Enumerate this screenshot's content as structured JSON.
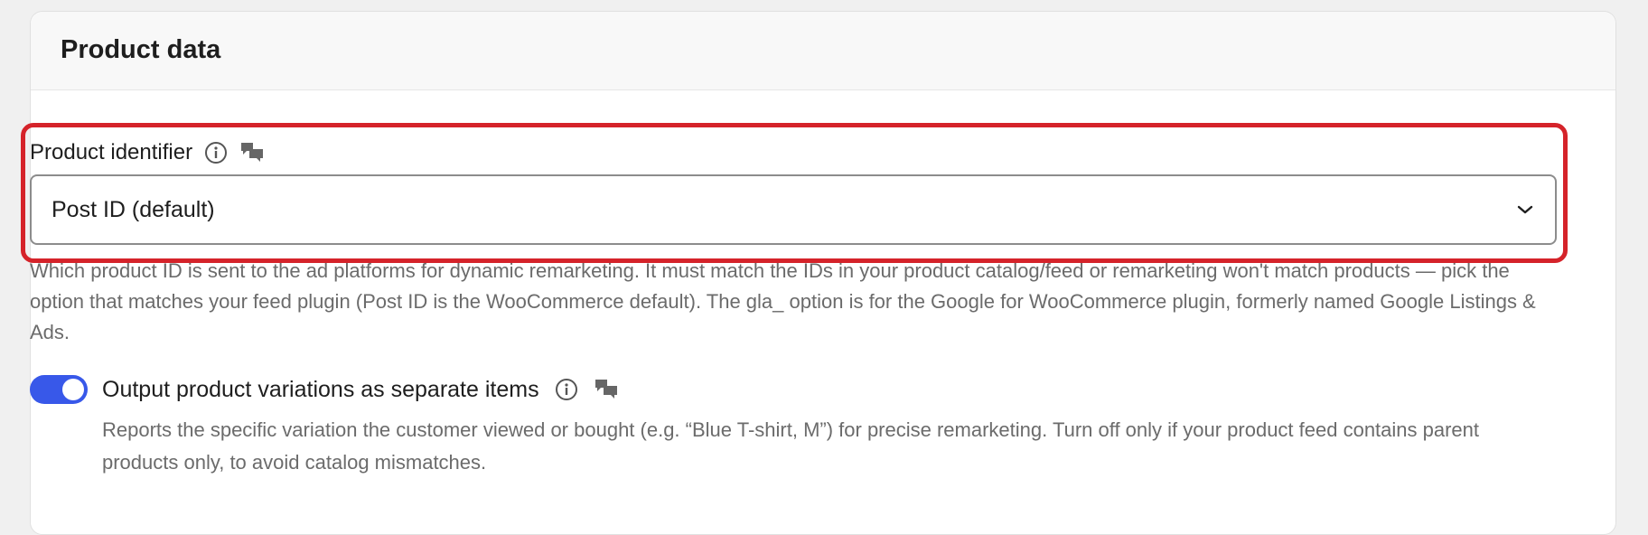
{
  "card": {
    "title": "Product data"
  },
  "product_identifier": {
    "label": "Product identifier",
    "info_icon": "info-circle-icon",
    "comment_icon": "speech-bubbles-icon",
    "selected_value": "Post ID (default)",
    "help_text": "Which product ID is sent to the ad platforms for dynamic remarketing. It must match the IDs in your product catalog/feed or remarketing won't match products — pick the option that matches your feed plugin (Post ID is the WooCommerce default). The gla_ option is for the Google for WooCommerce plugin, formerly named Google Listings & Ads."
  },
  "variations_toggle": {
    "label": "Output product variations as separate items",
    "enabled": true,
    "info_icon": "info-circle-icon",
    "comment_icon": "speech-bubbles-icon",
    "help_text": "Reports the specific variation the customer viewed or bought (e.g. “Blue T-shirt, M”) for precise remarketing. Turn off only if your product feed contains parent products only, to avoid catalog mismatches."
  },
  "colors": {
    "highlight": "#d5232a",
    "toggle_on": "#3858e9",
    "text": "#1e1e1e",
    "muted_text": "#6b6b6b"
  }
}
